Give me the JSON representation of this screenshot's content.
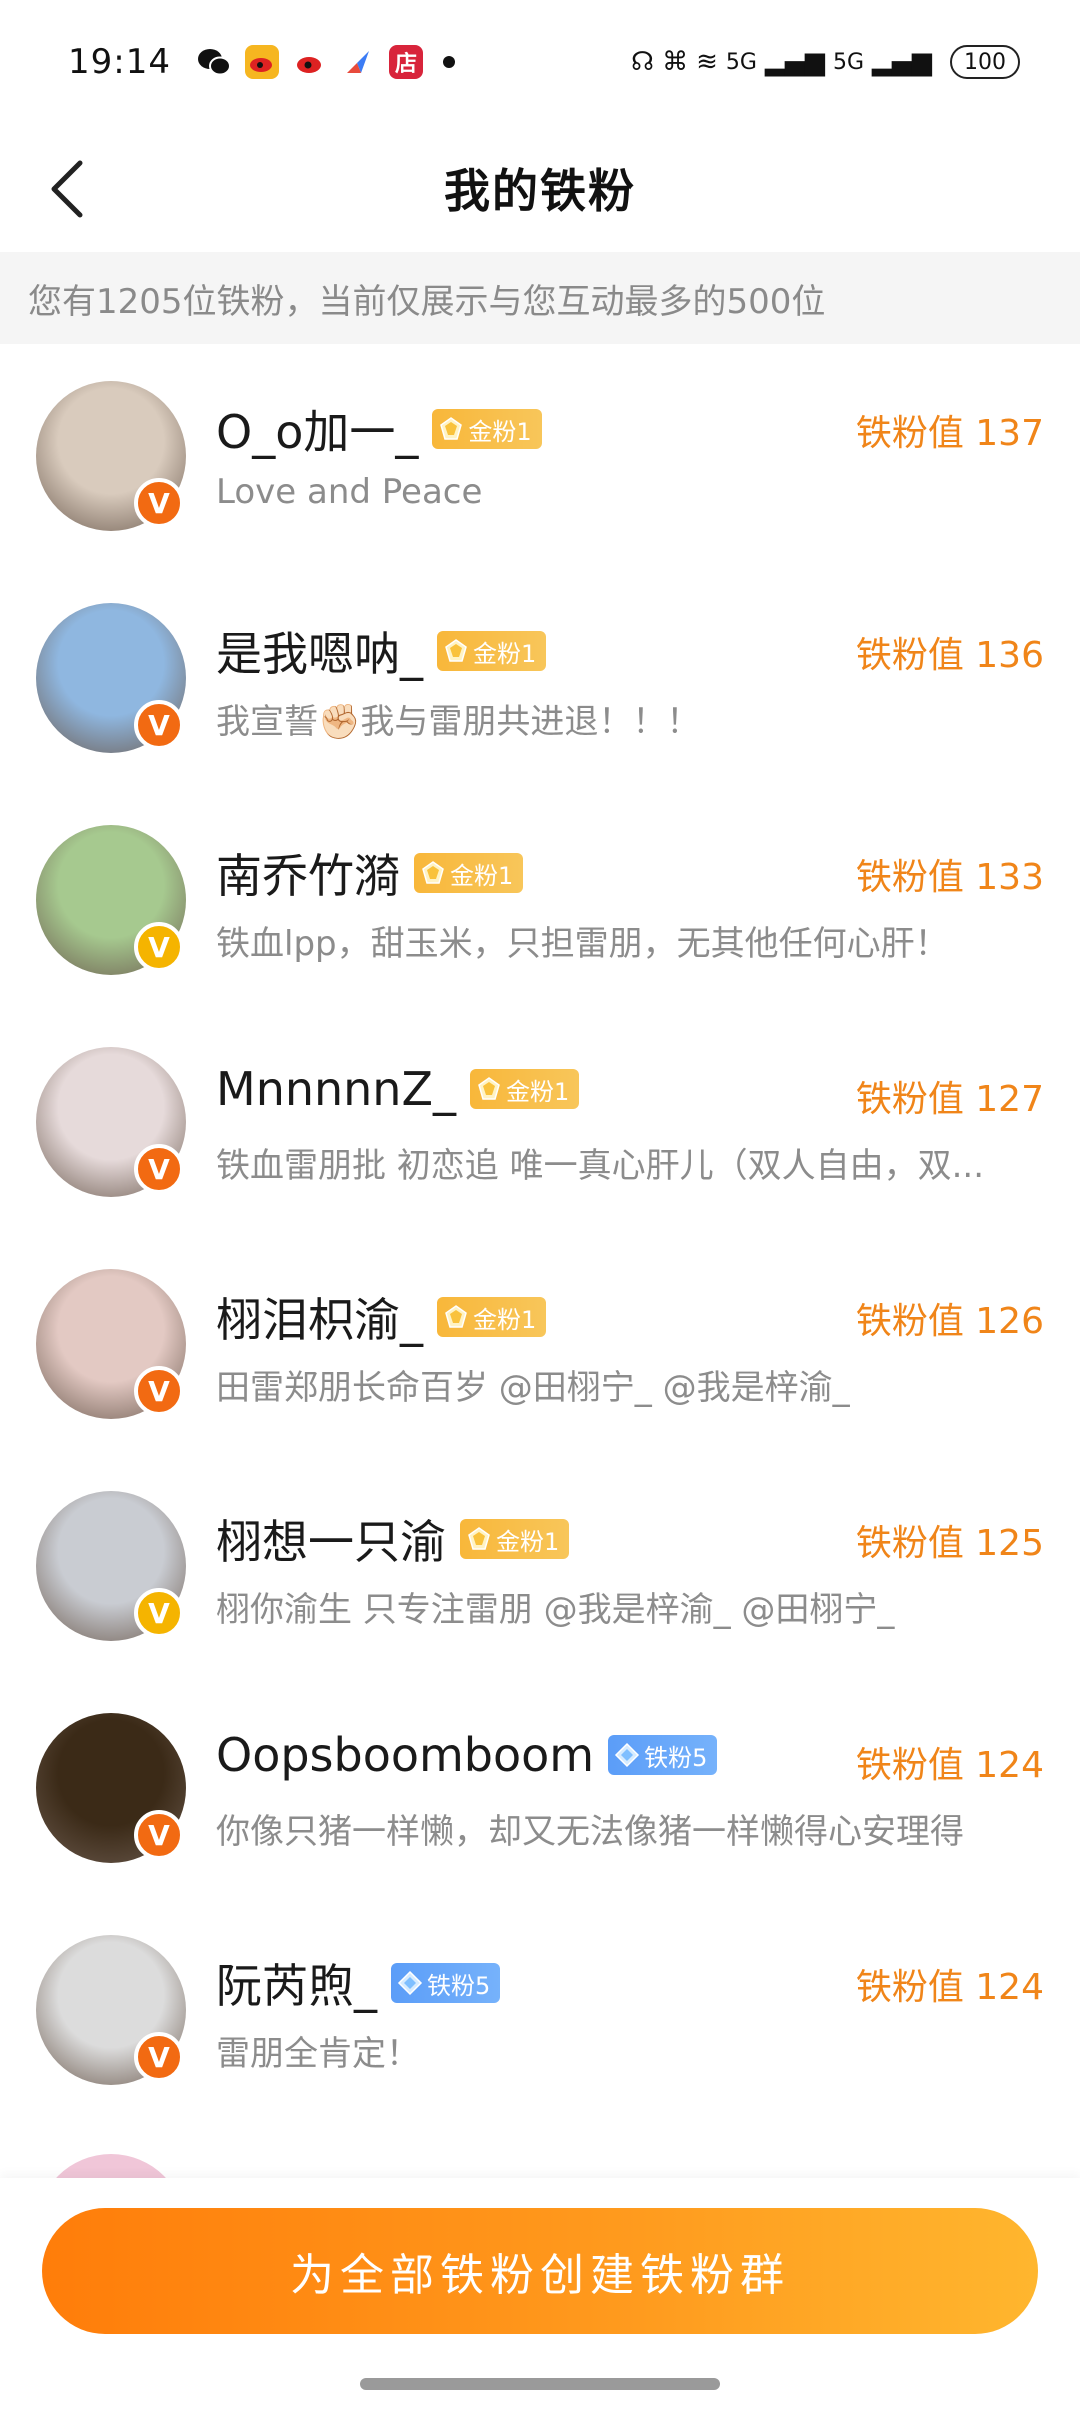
{
  "status_bar": {
    "time": "19:14",
    "network_label_1": "5G",
    "network_label_2": "5G",
    "battery": "100"
  },
  "header": {
    "title": "我的铁粉"
  },
  "notice": {
    "text": "您有1205位铁粉，当前仅展示与您互动最多的500位"
  },
  "fans": [
    {
      "name": "O_o加一_",
      "badge_type": "gold",
      "badge": "金粉1",
      "value": "铁粉值 137",
      "bio": "Love and Peace",
      "v_color": "#f26a12",
      "avatar_color": "#d9cbbd"
    },
    {
      "name": "是我嗯呐_",
      "badge_type": "gold",
      "badge": "金粉1",
      "value": "铁粉值 136",
      "bio": "我宣誓✊🏻我与雷朋共进退！！！",
      "v_color": "#f26a12",
      "avatar_color": "#8fb7e0"
    },
    {
      "name": "南乔竹漪",
      "badge_type": "gold",
      "badge": "金粉1",
      "value": "铁粉值 133",
      "bio": "铁血lpp，甜玉米，只担雷朋，无其他任何心肝！",
      "v_color": "#f5b400",
      "avatar_color": "#a6c98f"
    },
    {
      "name": "MnnnnnZ_",
      "badge_type": "gold",
      "badge": "金粉1",
      "value": "铁粉值 127",
      "bio": "铁血雷朋批 初恋追 唯一真心肝儿（双人自由，双...",
      "v_color": "#f26a12",
      "avatar_color": "#e6dada"
    },
    {
      "name": "栩泪枳渝_",
      "badge_type": "gold",
      "badge": "金粉1",
      "value": "铁粉值 126",
      "bio": "田雷郑朋长命百岁 @田栩宁_ @我是梓渝_",
      "v_color": "#f26a12",
      "avatar_color": "#e3c9c3"
    },
    {
      "name": "栩想一只渝",
      "badge_type": "gold",
      "badge": "金粉1",
      "value": "铁粉值 125",
      "bio": "栩你渝生 只专注雷朋 @我是梓渝_ @田栩宁_",
      "v_color": "#f5b400",
      "avatar_color": "#c9ccd2"
    },
    {
      "name": "Oopsboomboom",
      "badge_type": "iron",
      "badge": "铁粉5",
      "value": "铁粉值 124",
      "bio": "你像只猪一样懒，却又无法像猪一样懒得心安理得",
      "v_color": "#f26a12",
      "avatar_color": "#3b2a17"
    },
    {
      "name": "阮芮煦_",
      "badge_type": "iron",
      "badge": "铁粉5",
      "value": "铁粉值 124",
      "bio": "雷朋全肯定！",
      "v_color": "#f26a12",
      "avatar_color": "#dcdcdc"
    }
  ],
  "bottom": {
    "button_label": "为全部铁粉创建铁粉群"
  },
  "colors": {
    "accent": "#f08519",
    "button_start": "#ff7d0a",
    "button_end": "#ffb62e"
  }
}
